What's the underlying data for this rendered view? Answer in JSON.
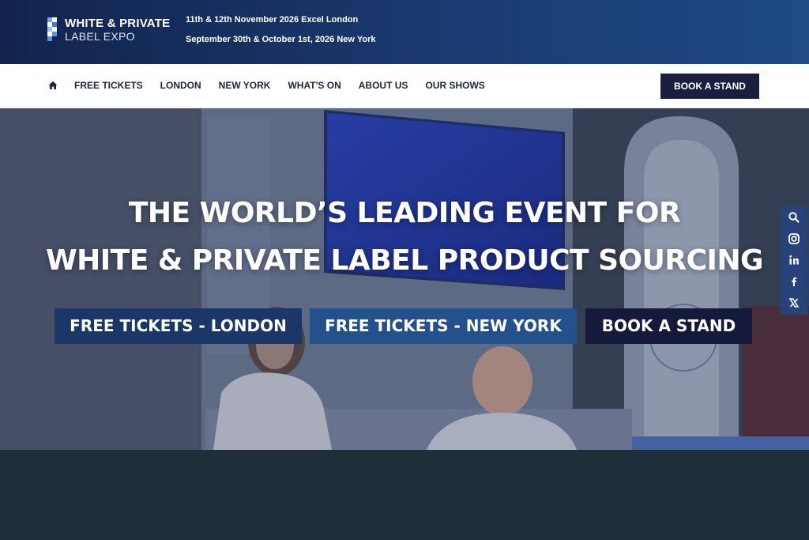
{
  "brand": {
    "line1": "WHITE & PRIVATE",
    "line2": "LABEL EXPO",
    "colors": {
      "navy": "#12244c",
      "dark": "#1b1f3f",
      "blue": "#24508c"
    }
  },
  "event_dates": [
    "11th & 12th November 2026 Excel London",
    "September 30th & October 1st, 2026 New York"
  ],
  "nav": {
    "home_icon": "home-icon",
    "links": [
      "FREE TICKETS",
      "LONDON",
      "NEW YORK",
      "WHAT'S ON",
      "ABOUT US",
      "OUR SHOWS"
    ],
    "cta": "BOOK A STAND"
  },
  "hero": {
    "title_line1": "THE WORLD’S LEADING EVENT FOR",
    "title_line2": "WHITE & PRIVATE LABEL PRODUCT SOURCING",
    "buttons": {
      "london": "FREE TICKETS - LONDON",
      "new_york": "FREE TICKETS - NEW YORK",
      "book": "BOOK A STAND"
    }
  },
  "social": {
    "icons": [
      "search-icon",
      "instagram-icon",
      "linkedin-icon",
      "facebook-icon",
      "x-icon"
    ]
  }
}
